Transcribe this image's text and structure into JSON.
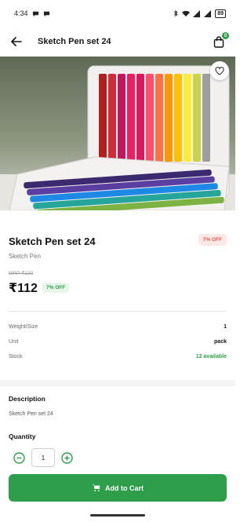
{
  "status_bar": {
    "time": "4:34",
    "battery": "89"
  },
  "app_bar": {
    "title": "Sketch Pen set 24",
    "cart_count": "0"
  },
  "product": {
    "title": "Sketch Pen set 24",
    "subtitle": "Sketch Pen",
    "top_discount": "7% OFF",
    "mrp": "MRP ₹120",
    "price": "₹112",
    "price_discount": "7% OFF"
  },
  "specs": [
    {
      "label": "Weight/Size",
      "value": "1"
    },
    {
      "label": "Unit",
      "value": "pack"
    },
    {
      "label": "Stock",
      "value": "12 available"
    }
  ],
  "description": {
    "title": "Description",
    "text": "Sketch Pen set 24"
  },
  "quantity": {
    "title": "Quantity",
    "value": "1"
  },
  "actions": {
    "add_to_cart": "Add to Cart"
  },
  "colors": {
    "accent_green": "#2e9e4a",
    "discount_red": "#e05a4a"
  },
  "icons": {
    "back": "arrow-left-icon",
    "cart": "shopping-bag-icon",
    "favorite": "heart-outline-icon",
    "minus": "minus-circle-icon",
    "plus": "plus-circle-icon",
    "add_cart": "cart-icon"
  }
}
